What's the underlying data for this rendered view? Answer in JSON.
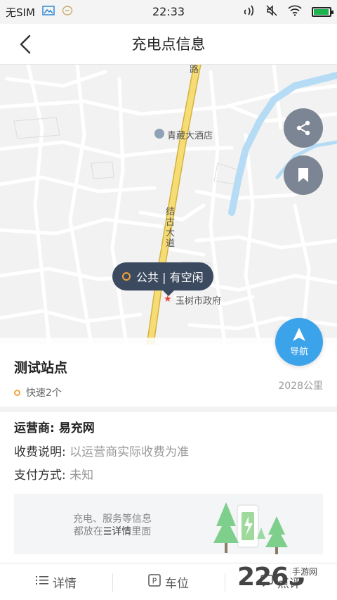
{
  "status_bar": {
    "carrier": "无SIM",
    "time": "22:33",
    "battery_level": 0.95,
    "battery_color": "#1db34f"
  },
  "header": {
    "title": "充电点信息"
  },
  "map": {
    "road_label_top": "路",
    "road_label_main": "结古大道",
    "poi_hotel": "青藏大酒店",
    "poi_government": "玉树市政府",
    "marker_text": "公共 | 有空闲",
    "navigate_label": "导航"
  },
  "station": {
    "name": "测试站点",
    "fast_chargers": "快速2个",
    "distance": "2028公里"
  },
  "details": {
    "operator_label": "运营商: ",
    "operator_value": "易充网",
    "fee_label": "收费说明: ",
    "fee_value": "以运营商实际收费为准",
    "payment_label": "支付方式: ",
    "payment_value": "未知"
  },
  "promo": {
    "line1": "充电、服务等信息",
    "line2_prefix": "都放在",
    "line2_highlight": "详情",
    "line2_suffix": "里面"
  },
  "tabs": [
    {
      "label": "详情",
      "icon": "list-icon"
    },
    {
      "label": "车位",
      "icon": "parking-icon"
    },
    {
      "label": "点评",
      "icon": "comment-icon"
    }
  ],
  "watermark": {
    "number": "2265",
    "text": "手游网"
  },
  "colors": {
    "accent_blue": "#3ba3ea",
    "marker_bg": "#3c4a5f",
    "ring_orange": "#f2a33a",
    "main_road": "#f6dc74",
    "river": "#b6dcf5"
  }
}
